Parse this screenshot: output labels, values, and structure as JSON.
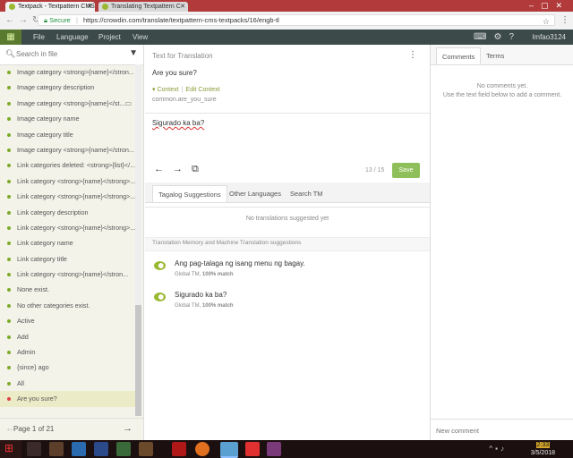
{
  "browser": {
    "tabs": [
      {
        "label": "Textpack - Textpattern CMS",
        "active": true
      },
      {
        "label": "Translating Textpattern C",
        "active": false
      }
    ],
    "secure_label": "Secure",
    "url": "https://crowdin.com/translate/textpattern-cms-textpacks/16/engb-tl"
  },
  "appbar": {
    "menu": [
      "File",
      "Language",
      "Project",
      "View"
    ],
    "username": "lmfao3124"
  },
  "left": {
    "search_placeholder": "Search in file",
    "items": [
      {
        "label": "Image category <strong>{name}</stron..."
      },
      {
        "label": "Image category description"
      },
      {
        "label": "Image category <strong>{name}</st..."
      },
      {
        "label": "Image category name"
      },
      {
        "label": "Image category title"
      },
      {
        "label": "Image category <strong>{name}</stron..."
      },
      {
        "label": "Link categories deleted: <strong>{list}</..."
      },
      {
        "label": "Link category <strong>{name}</strong>..."
      },
      {
        "label": "Link category <strong>{name}</strong>..."
      },
      {
        "label": "Link category description"
      },
      {
        "label": "Link category <strong>{name}</strong>..."
      },
      {
        "label": "Link category name"
      },
      {
        "label": "Link category title"
      },
      {
        "label": "Link category <strong>{name}</stron..."
      },
      {
        "label": "None exist."
      },
      {
        "label": "No other categories exist."
      },
      {
        "label": "Active"
      },
      {
        "label": "Add"
      },
      {
        "label": "Admin"
      },
      {
        "label": "{since} ago"
      },
      {
        "label": "All"
      },
      {
        "label": "Are you sure?"
      }
    ],
    "pager": "Page 1 of 21"
  },
  "center": {
    "source_header": "Text for Translation",
    "source_text": "Are you sure?",
    "context_label": "Context",
    "edit_context_label": "Edit Context",
    "string_key": "common.are_you_sure",
    "translation": "Sigurado ka ba?",
    "counter": "13 / 15",
    "save_label": "Save",
    "tabs": [
      "Tagalog Suggestions",
      "Other Languages",
      "Search TM"
    ],
    "no_suggestions": "No translations suggested yet",
    "tm_header": "Translation Memory and Machine Translation suggestions",
    "tm_suggestions": [
      {
        "text": "Ang pag-talaga ng isang menu ng bagay.",
        "source": "Global TM,",
        "match": "100% match"
      },
      {
        "text": "Sigurado ka ba?",
        "source": "Global TM,",
        "match": "100% match"
      }
    ]
  },
  "right": {
    "tabs": [
      "Comments",
      "Terms"
    ],
    "no_comments": "No comments yet.",
    "no_comments_hint": "Use the text field below to add a comment.",
    "new_comment_placeholder": "New comment"
  },
  "taskbar": {
    "time": "2:33",
    "date": "3/5/2018"
  },
  "colors": {
    "tabbar": "#b23a3a",
    "appbar": "#3c4a4a",
    "accent_green": "#8fbf5a",
    "dot_green": "#7cab2a",
    "active_dot": "#dd4444"
  }
}
